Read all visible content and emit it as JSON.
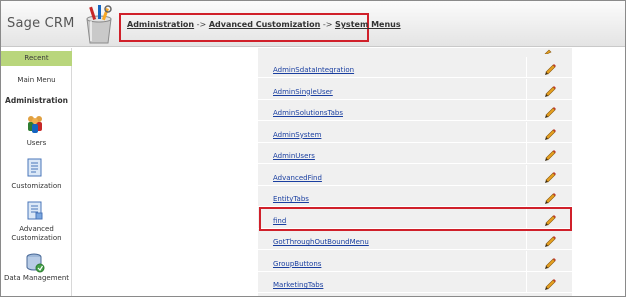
{
  "app": {
    "title": "Sage CRM"
  },
  "breadcrumb": {
    "item1": "Administration",
    "sep1": "->",
    "item2": "Advanced Customization",
    "sep2": "->",
    "item3": "System Menus"
  },
  "sidebar": {
    "recent": "Recent",
    "main_menu": "Main Menu",
    "section": "Administration",
    "items": [
      {
        "label": "Users",
        "icon": "users-icon"
      },
      {
        "label": "Customization",
        "icon": "document-icon"
      },
      {
        "label": "Advanced Customization",
        "icon": "advanced-customization-icon"
      },
      {
        "label": "Data Management",
        "icon": "data-management-icon"
      }
    ]
  },
  "menus": {
    "rows": [
      "AdminSdataIntegration",
      "AdminSingleUser",
      "AdminSolutionsTabs",
      "AdminSystem",
      "AdminUsers",
      "AdvancedFind",
      "EntityTabs",
      "find",
      "GotThroughOutBoundMenu",
      "GroupButtons",
      "MarketingTabs"
    ],
    "edit_icon": "pencil-icon",
    "highlighted_row": "find"
  },
  "colors": {
    "highlight": "#d0202a",
    "recent_bg": "#b9d67c",
    "link": "#1a3fa0"
  }
}
